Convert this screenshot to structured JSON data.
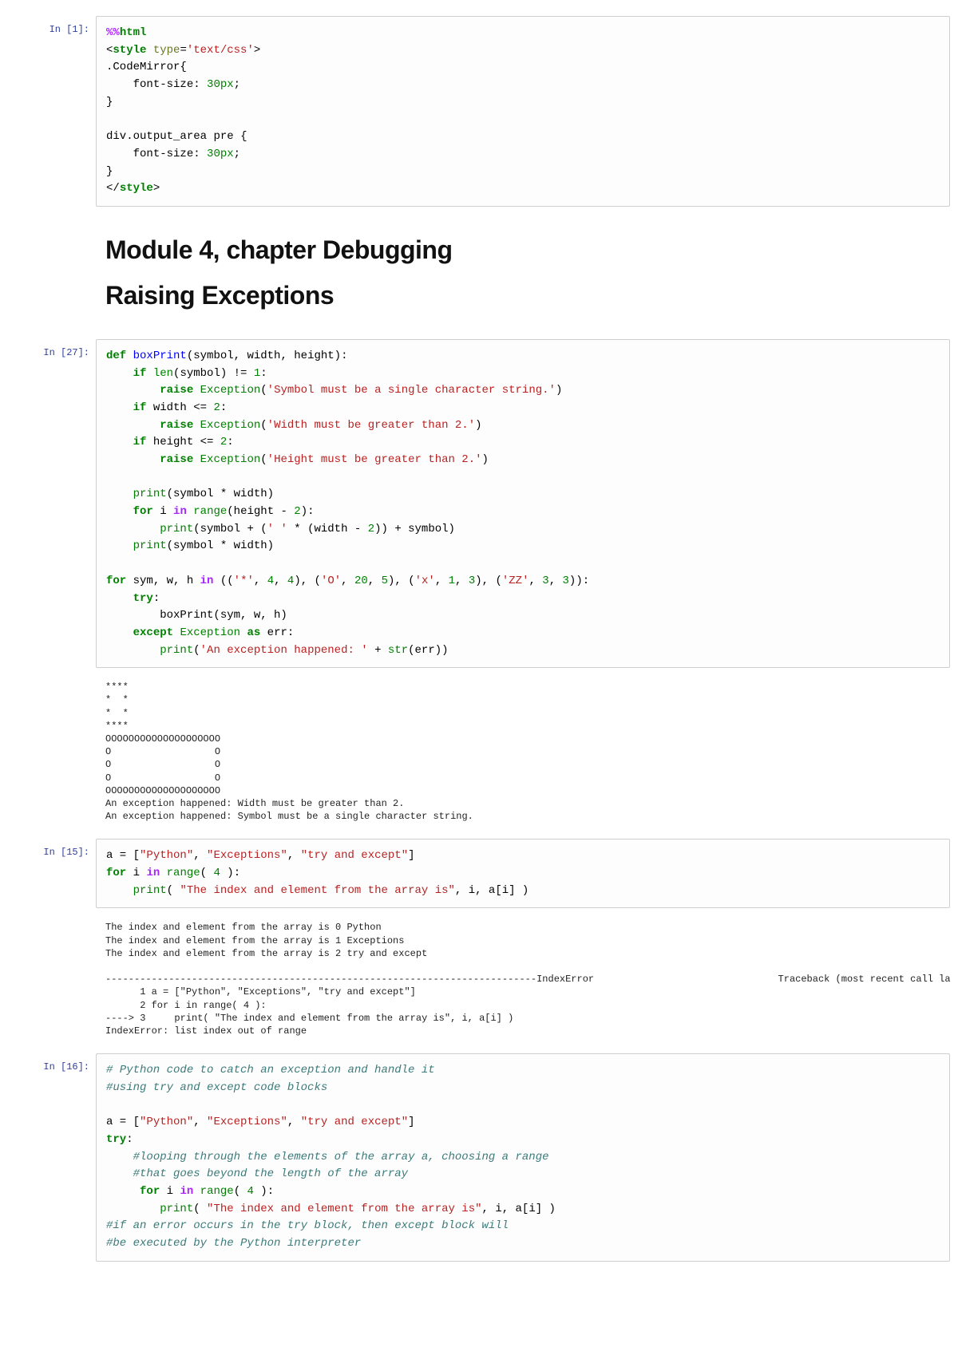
{
  "cells": [
    {
      "prompt": "In [1]:",
      "code_html": "<span class='c-mag'>%%</span><span class='c-tag'>html</span>\n&lt;<span class='c-tag'>style</span> <span class='c-at'>type</span>=<span class='c-str'>'text/css'</span>&gt;\n.<span class='c-bk'>CodeMirror</span>{\n    <span class='c-bk'>font-size</span>: <span class='c-num'>30px</span>;\n}\n\n<span class='c-bk'>div</span>.<span class='c-bk'>output_area</span> <span class='c-bk'>pre</span> {\n    <span class='c-bk'>font-size</span>: <span class='c-num'>30px</span>;\n}\n&lt;/<span class='c-tag'>style</span>&gt;"
    },
    {
      "is_markdown": true,
      "title1": "Module 4, chapter Debugging",
      "title2": "Raising Exceptions"
    },
    {
      "prompt": "In [27]:",
      "code_html": "<span class='c-kw'>def</span> <span class='c-fn'>boxPrint</span>(symbol, width, height):\n    <span class='c-kw'>if</span> <span class='c-bi'>len</span>(symbol) != <span class='c-num'>1</span>:\n        <span class='c-kw'>raise</span> <span class='c-bi'>Exception</span>(<span class='c-str'>'Symbol must be a single character string.'</span>)\n    <span class='c-kw'>if</span> width &lt;= <span class='c-num'>2</span>:\n        <span class='c-kw'>raise</span> <span class='c-bi'>Exception</span>(<span class='c-str'>'Width must be greater than 2.'</span>)\n    <span class='c-kw'>if</span> height &lt;= <span class='c-num'>2</span>:\n        <span class='c-kw'>raise</span> <span class='c-bi'>Exception</span>(<span class='c-str'>'Height must be greater than 2.'</span>)\n\n    <span class='c-bi'>print</span>(symbol * width)\n    <span class='c-kw'>for</span> i <span class='c-op'>in</span> <span class='c-bi'>range</span>(height - <span class='c-num'>2</span>):\n        <span class='c-bi'>print</span>(symbol + (<span class='c-str'>' '</span> * (width - <span class='c-num'>2</span>)) + symbol)\n    <span class='c-bi'>print</span>(symbol * width)\n\n<span class='c-kw'>for</span> sym, w, h <span class='c-op'>in</span> ((<span class='c-str'>'*'</span>, <span class='c-num'>4</span>, <span class='c-num'>4</span>), (<span class='c-str'>'O'</span>, <span class='c-num'>20</span>, <span class='c-num'>5</span>), (<span class='c-str'>'x'</span>, <span class='c-num'>1</span>, <span class='c-num'>3</span>), (<span class='c-str'>'ZZ'</span>, <span class='c-num'>3</span>, <span class='c-num'>3</span>)):\n    <span class='c-kw'>try</span>:\n        boxPrint(sym, w, h)\n    <span class='c-kw'>except</span> <span class='c-bi'>Exception</span> <span class='c-kw'>as</span> err:\n        <span class='c-bi'>print</span>(<span class='c-str'>'An exception happened: '</span> + <span class='c-bi'>str</span>(err))",
      "output": "****\n*  *\n*  *\n****\nOOOOOOOOOOOOOOOOOOOO\nO                  O\nO                  O\nO                  O\nOOOOOOOOOOOOOOOOOOOO\nAn exception happened: Width must be greater than 2.\nAn exception happened: Symbol must be a single character string."
    },
    {
      "prompt": "In [15]:",
      "code_html": "a = [<span class='c-str'>\"Python\"</span>, <span class='c-str'>\"Exceptions\"</span>, <span class='c-str'>\"try and except\"</span>]\n<span class='c-kw'>for</span> i <span class='c-op'>in</span> <span class='c-bi'>range</span>( <span class='c-num'>4</span> ):\n    <span class='c-bi'>print</span>( <span class='c-str'>\"The index and element from the array is\"</span>, i, a[i] )",
      "output": "The index and element from the array is 0 Python\nThe index and element from the array is 1 Exceptions\nThe index and element from the array is 2 try and except\n\n---------------------------------------------------------------------------IndexError                                Traceback (most recent call last)\n      1 a = [\"Python\", \"Exceptions\", \"try and except\"]\n      2 for i in range( 4 ):\n----> 3     print( \"The index and element from the array is\", i, a[i] )\nIndexError: list index out of range"
    },
    {
      "prompt": "In [16]:",
      "code_html": "<span class='c-cmt'># Python code to catch an exception and handle it</span>\n<span class='c-cmt'>#using try and except code blocks</span>\n\na = [<span class='c-str'>\"Python\"</span>, <span class='c-str'>\"Exceptions\"</span>, <span class='c-str'>\"try and except\"</span>]\n<span class='c-kw'>try</span>:\n    <span class='c-cmt'>#looping through the elements of the array a, choosing a range</span>\n    <span class='c-cmt'>#that goes beyond the length of the array</span>\n     <span class='c-kw'>for</span> i <span class='c-op'>in</span> <span class='c-bi'>range</span>( <span class='c-num'>4</span> ):\n        <span class='c-bi'>print</span>( <span class='c-str'>\"The index and element from the array is\"</span>, i, a[i] )\n<span class='c-cmt'>#if an error occurs in the try block, then except block will</span>\n<span class='c-cmt'>#be executed by the Python interpreter</span>"
    }
  ]
}
